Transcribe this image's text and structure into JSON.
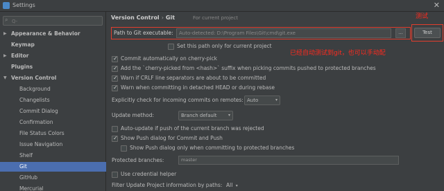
{
  "window": {
    "title": "Settings",
    "close": "✕"
  },
  "search": {
    "placeholder": "Q-"
  },
  "sidebar": {
    "items": [
      {
        "label": "Appearance & Behavior"
      },
      {
        "label": "Keymap"
      },
      {
        "label": "Editor"
      },
      {
        "label": "Plugins"
      },
      {
        "label": "Version Control"
      },
      {
        "label": "Background"
      },
      {
        "label": "Changelists"
      },
      {
        "label": "Commit Dialog"
      },
      {
        "label": "Confirmation"
      },
      {
        "label": "File Status Colors"
      },
      {
        "label": "Issue Navigation"
      },
      {
        "label": "Shelf"
      },
      {
        "label": "Git"
      },
      {
        "label": "GitHub"
      },
      {
        "label": "Mercurial"
      }
    ]
  },
  "breadcrumb": {
    "parent": "Version Control",
    "sep": "›",
    "current": "Git",
    "note": "For current project"
  },
  "path": {
    "label": "Path to Git executable:",
    "value": "Auto-detected: D:\\Program Files\\Git\\cmd\\git.exe",
    "browse": "...",
    "test_button": "Test",
    "set_only_current": "Set this path only for current project"
  },
  "annotations": {
    "test": "测试",
    "autodetect": "已经自动测试到git，也可以手动配"
  },
  "options": {
    "commit_cherry_pick": "Commit automatically on cherry-pick",
    "cherry_suffix": "Add the `cherry-picked from <hash>` suffix when picking commits pushed to protected branches",
    "warn_crlf": "Warn if CRLF line separators are about to be committed",
    "warn_detached": "Warn when committing in detached HEAD or during rebase",
    "explicit_check_label": "Explicitly check for incoming commits on remotes:",
    "explicit_check_value": "Auto",
    "update_method_label": "Update method:",
    "update_method_value": "Branch default",
    "auto_update": "Auto-update if push of the current branch was rejected",
    "show_push": "Show Push dialog for Commit and Push",
    "show_push_protected": "Show Push dialog only when committing to protected branches",
    "protected_label": "Protected branches:",
    "protected_value": "master",
    "credential_helper": "Use credential helper",
    "filter_label": "Filter Update Project information by paths:",
    "filter_value": "All"
  },
  "icons": {
    "caret": "▾",
    "arrow_right": "▶",
    "arrow_down": "▼",
    "search": "🔍"
  }
}
